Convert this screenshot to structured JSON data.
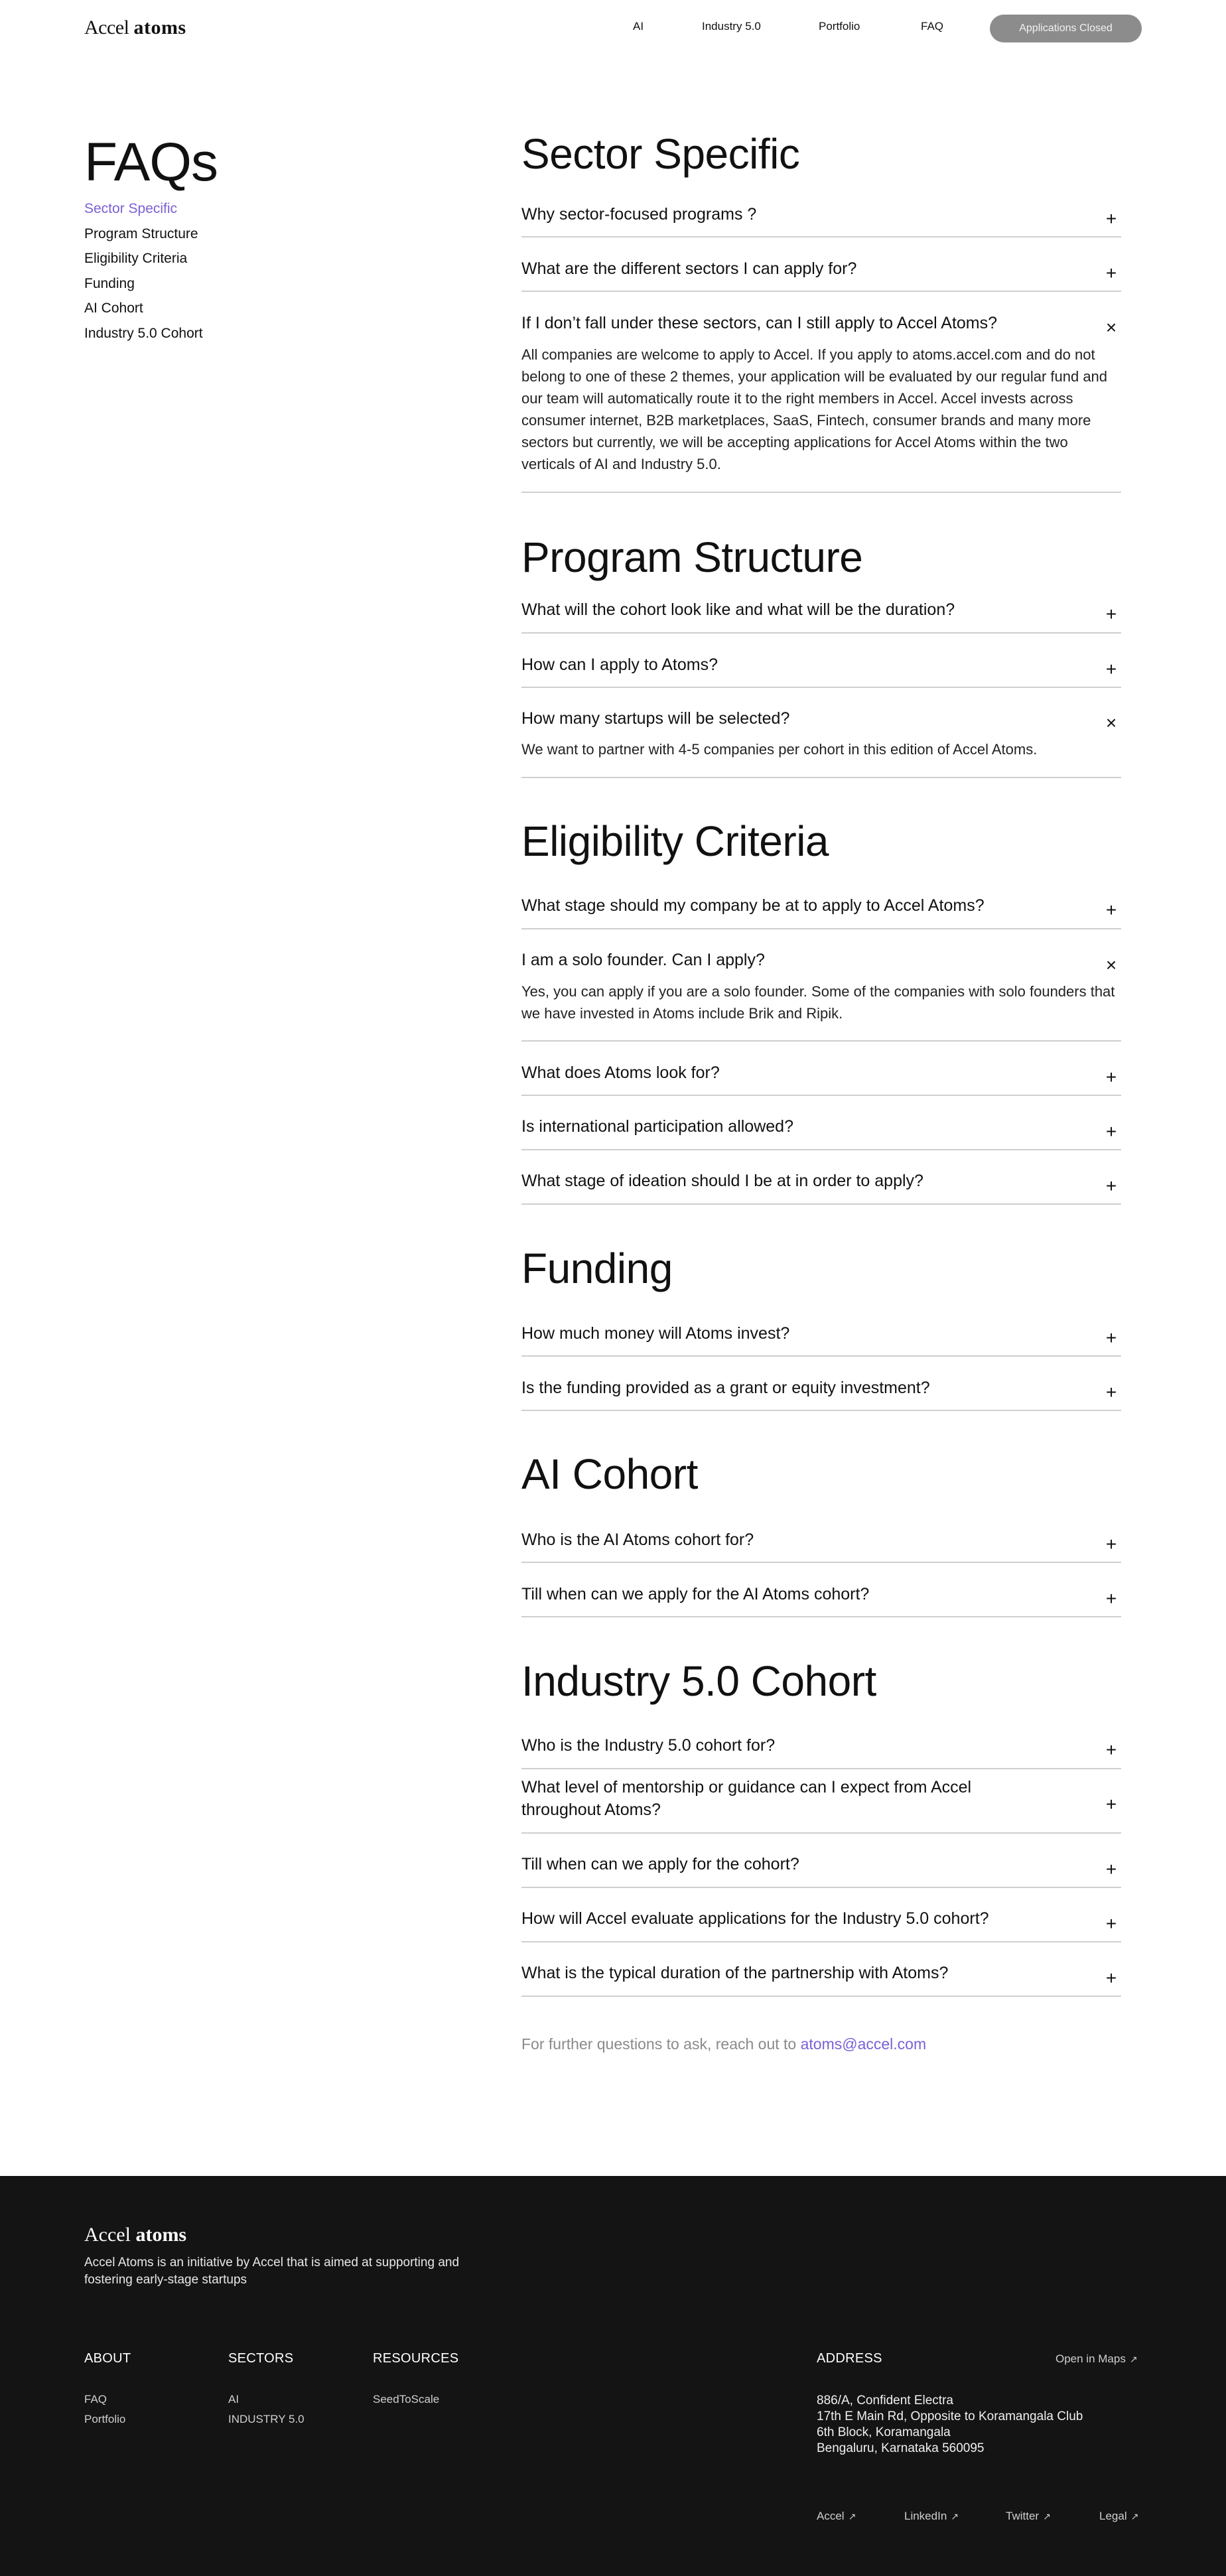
{
  "header": {
    "logo_prefix": "Accel",
    "logo_suffix": "atoms",
    "nav": [
      "AI",
      "Industry 5.0",
      "Portfolio",
      "FAQ"
    ],
    "cta": "Applications Closed"
  },
  "sidebar": {
    "title": "FAQs",
    "items": [
      "Sector Specific",
      "Program Structure",
      "Eligibility Criteria",
      "Funding",
      "AI Cohort",
      "Industry 5.0 Cohort"
    ]
  },
  "sections": {
    "sector": {
      "title": "Sector Specific",
      "q1": "Why sector-focused programs ?",
      "q2": "What are the different sectors I can apply for?",
      "q3": "If I don’t fall under these sectors, can I still apply to Accel Atoms?",
      "a3": "All companies are welcome to apply to Accel. If you apply to atoms.accel.com and do not belong to one of these 2 themes, your application will be evaluated by our regular fund and our team will automatically route it to the right members in Accel. Accel invests across consumer internet, B2B marketplaces, SaaS, Fintech, consumer brands and many more sectors but currently, we will be accepting applications for Accel Atoms within the two verticals of AI and Industry 5.0."
    },
    "program": {
      "title": "Program Structure",
      "q1": "What will the cohort look like and what will be the duration?",
      "q2": "How can I apply to Atoms?",
      "q3": "How many startups will be selected?",
      "a3": "We want to partner with 4-5 companies per cohort in this edition of Accel Atoms."
    },
    "eligibility": {
      "title": "Eligibility Criteria",
      "q1": "What stage should my company be at to apply to Accel Atoms?",
      "q2": "I am a solo founder. Can I apply?",
      "a2": "Yes, you can apply if you are a solo founder. Some of the companies with solo founders that we have invested in Atoms include Brik and Ripik.",
      "q3": "What does Atoms look for?",
      "q4": "Is international participation allowed?",
      "q5": "What stage of ideation should I be at in order to apply?"
    },
    "funding": {
      "title": "Funding",
      "q1": "How much money will Atoms invest?",
      "q2": "Is the funding provided as a grant or equity investment?"
    },
    "ai": {
      "title": "AI Cohort",
      "q1": "Who is the AI Atoms cohort for?",
      "q2": "Till when can we apply for the AI Atoms cohort?"
    },
    "industry": {
      "title": "Industry 5.0 Cohort",
      "q1": "Who is the Industry 5.0 cohort for?",
      "q2": "What level of mentorship or guidance can I expect from Accel throughout Atoms?",
      "q3": "Till when can we apply for the cohort?",
      "q4": "How will Accel evaluate applications for the Industry 5.0 cohort?",
      "q5": "What is the typical duration of the partnership with Atoms?"
    }
  },
  "icons": {
    "collapsed": "+",
    "expanded": "×"
  },
  "further": {
    "text": "For further questions to ask, reach out to",
    "email": "atoms@accel.com"
  },
  "footer": {
    "logo_prefix": "Accel",
    "logo_suffix": "atoms",
    "tagline": "Accel Atoms is an initiative by Accel that is aimed at supporting and fostering early-stage startups",
    "about": {
      "heading": "ABOUT",
      "links": [
        "FAQ",
        "Portfolio"
      ]
    },
    "sectors": {
      "heading": "SECTORS",
      "links": [
        "AI",
        "INDUSTRY 5.0"
      ]
    },
    "resources": {
      "heading": "RESOURCES",
      "links": [
        "SeedToScale"
      ]
    },
    "address": {
      "heading": "ADDRESS",
      "maps": "Open in Maps",
      "lines": [
        "886/A, Confident Electra",
        "17th E Main Rd, Opposite to Koramangala Club",
        "6th Block, Koramangala",
        "Bengaluru, Karnataka 560095"
      ]
    },
    "social": [
      "Accel",
      "LinkedIn",
      "Twitter",
      "Legal"
    ],
    "arrow": "↗"
  }
}
